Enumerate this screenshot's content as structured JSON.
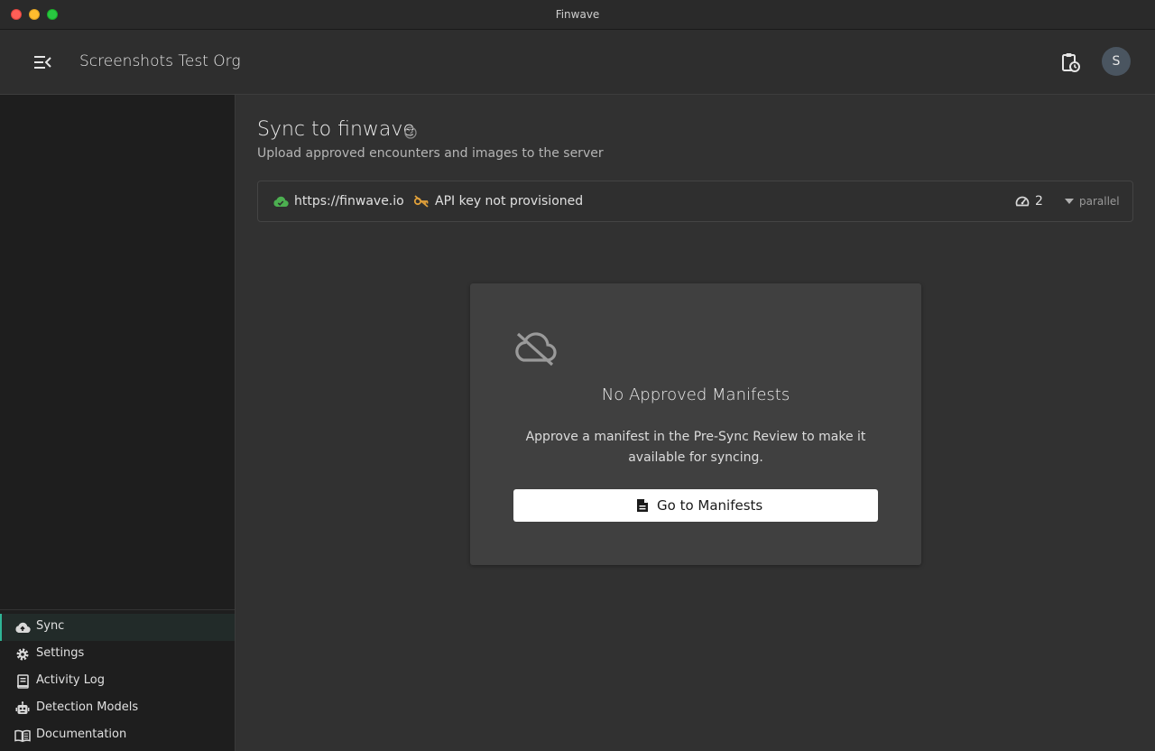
{
  "window": {
    "title": "Finwave"
  },
  "header": {
    "org_name": "Screenshots Test Org",
    "avatar_initial": "S"
  },
  "sidebar": {
    "items": [
      {
        "label": "Sync",
        "icon": "cloud-upload-icon",
        "active": true
      },
      {
        "label": "Settings",
        "icon": "gear-icon",
        "active": false
      },
      {
        "label": "Activity Log",
        "icon": "log-book-icon",
        "active": false
      },
      {
        "label": "Detection Models",
        "icon": "robot-icon",
        "active": false
      },
      {
        "label": "Documentation",
        "icon": "book-open-icon",
        "active": false
      }
    ]
  },
  "main": {
    "title": "Sync to finwave",
    "subtitle": "Upload approved encounters and images to the server",
    "status": {
      "server_url": "https://finwave.io",
      "api_key_status": "API key not provisioned",
      "parallel_count": "2",
      "parallel_label": "parallel"
    },
    "empty_state": {
      "icon": "cloud-off-icon",
      "title": "No Approved Manifests",
      "message": "Approve a manifest in the Pre-Sync Review to make it available for syncing.",
      "button_label": "Go to Manifests"
    }
  },
  "colors": {
    "accent": "#2fb596",
    "success": "#4caf50",
    "warning": "#e0a03a"
  }
}
